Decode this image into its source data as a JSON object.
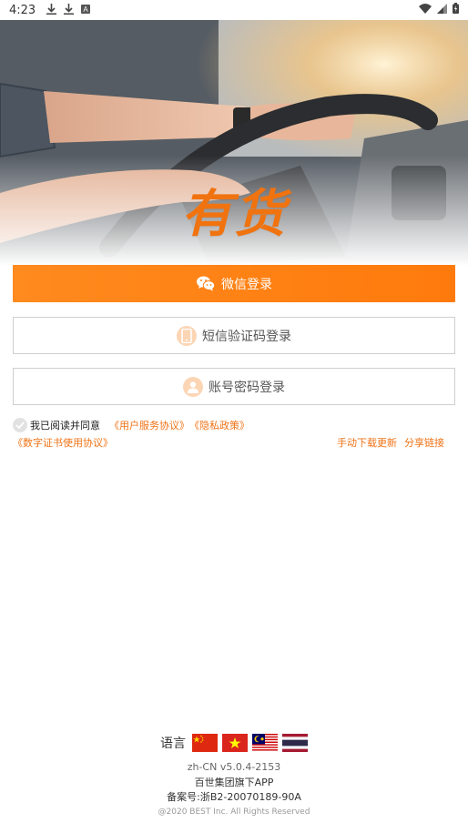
{
  "status_bar": {
    "time": "4:23",
    "left_icons": [
      "download-icon",
      "download-icon",
      "a-badge-icon"
    ],
    "right_icons": [
      "wifi-icon",
      "signal-icon",
      "battery-icon"
    ]
  },
  "brand": {
    "logo_text": "有货",
    "accent_color": "#f0730f"
  },
  "buttons": {
    "wechat_label": "微信登录",
    "sms_label": "短信验证码登录",
    "account_label": "账号密码登录"
  },
  "agreement": {
    "prefix": "我已阅读并同意",
    "user_service": "《用户服务协议》",
    "privacy": "《隐私政策》",
    "digital_cert": "《数字证书使用协议》",
    "manual_download": "手动下载更新",
    "share_link": "分享链接"
  },
  "footer": {
    "language_label": "语言",
    "languages": [
      "zh-CN",
      "vi",
      "ms",
      "th"
    ],
    "version": "zh-CN v5.0.4-2153",
    "company": "百世集团旗下APP",
    "icp": "备案号:浙B2-20070189-90A",
    "copyright": "@2020 BEST Inc. All Rights Reserved"
  }
}
